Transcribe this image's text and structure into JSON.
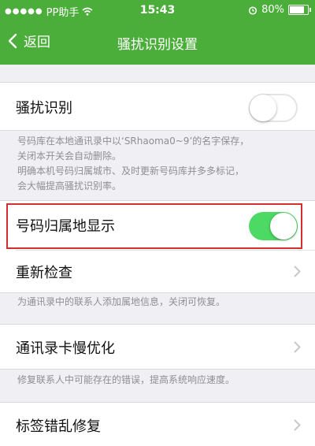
{
  "status_bar": {
    "carrier": "PP助手",
    "time": "15:43",
    "battery": "80%"
  },
  "nav": {
    "back_label": "返回",
    "title": "骚扰识别设置"
  },
  "harass": {
    "label": "骚扰识别",
    "toggle_on": false,
    "desc_lines": [
      "号码库在本地通讯录中以‘SRhaoma0~9’的名字保存，",
      "关闭本开关会自动删除。",
      "明确本机号码归属城市、及时更新号码库并多多标记，",
      "会大幅提高骚扰识别率。"
    ]
  },
  "location": {
    "label": "号码归属地显示",
    "toggle_on": true
  },
  "recheck": {
    "label": "重新检查",
    "desc": "为通讯录中的联系人添加属地信息，关闭可恢复。"
  },
  "optimize": {
    "label": "通讯录卡慢优化",
    "desc": "修复联系人中可能存在的错误，提高系统响应速度。"
  },
  "tag_fix": {
    "label": "标签错乱修复"
  },
  "colors": {
    "header_green": "#4cae3a",
    "toggle_green": "#4cd964",
    "highlight_red": "#d32f2f"
  }
}
